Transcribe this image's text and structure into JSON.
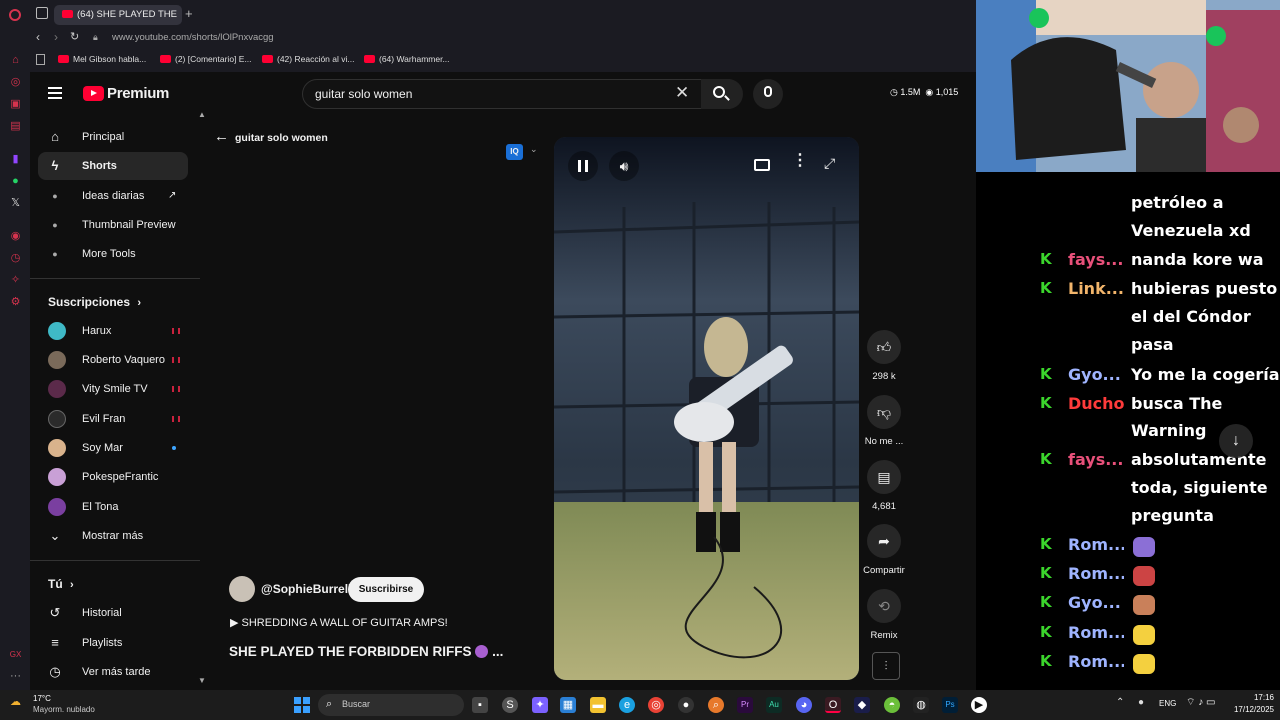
{
  "browser": {
    "tab_title": "(64) SHE PLAYED THE",
    "url": "www.youtube.com/shorts/lOlPnxvacgg",
    "bookmarks": [
      "Mel Gibson habla...",
      "(2) [Comentario] E...",
      "(42) Reacción al vi...",
      "(64) Warhammer..."
    ]
  },
  "youtube": {
    "brand": "Premium",
    "search_value": "guitar solo women",
    "stats": {
      "views": "1.5M",
      "watching": "1,015"
    },
    "nav": [
      {
        "label": "Principal",
        "icon": "home-icon"
      },
      {
        "label": "Shorts",
        "icon": "shorts-icon"
      },
      {
        "label": "Ideas diarias",
        "icon": "iq-icon"
      },
      {
        "label": "Thumbnail Preview",
        "icon": "iq-icon"
      },
      {
        "label": "More Tools",
        "icon": "iq-icon"
      }
    ],
    "subs_title": "Suscripciones",
    "subscriptions": [
      {
        "name": "Harux",
        "color": "#3fb9c6"
      },
      {
        "name": "Roberto Vaquero",
        "color": "#7a6a5a"
      },
      {
        "name": "Vity Smile TV",
        "color": "#5b2a4a"
      },
      {
        "name": "Evil Fran",
        "color": "#2b2b2b"
      },
      {
        "name": "Soy Mar",
        "color": "#d9b38c"
      },
      {
        "name": "PokespeFrantic",
        "color": "#c9a0d6"
      },
      {
        "name": "El Tona",
        "color": "#7a3fa0"
      }
    ],
    "show_more": "Mostrar más",
    "you_title": "Tú",
    "you_items": [
      {
        "label": "Historial",
        "icon": "history-icon"
      },
      {
        "label": "Playlists",
        "icon": "playlist-icon"
      },
      {
        "label": "Ver más tarde",
        "icon": "clock-icon"
      }
    ],
    "back_label": "guitar solo women",
    "channel": "@SophieBurrell",
    "subscribe": "Suscribirse",
    "playlist_line": "SHREDDING A WALL OF GUITAR AMPS!",
    "video_title": "SHE PLAYED THE FORBIDDEN RIFFS",
    "title_ellipsis": "...",
    "actions": {
      "likes": "298 k",
      "dislike": "No me ...",
      "comments": "4,681",
      "share": "Compartir",
      "remix": "Remix"
    }
  },
  "chat": {
    "lines": [
      {
        "user": "",
        "msg": "petróleo a",
        "color": "#fff"
      },
      {
        "user": "",
        "msg": "Venezuela xd",
        "color": "#fff"
      },
      {
        "user": "fays...",
        "msg": "nanda kore wa",
        "color": "#e8507a"
      },
      {
        "user": "Link...",
        "msg": "hubieras puesto",
        "color": "#f2b56b"
      },
      {
        "user": "",
        "msg": "el del Cóndor",
        "color": "#fff"
      },
      {
        "user": "",
        "msg": "pasa",
        "color": "#fff"
      },
      {
        "user": "Gyo...",
        "msg": "Yo me la cogería",
        "color": "#9fb4ff"
      },
      {
        "user": "Ducho",
        "msg": "busca The",
        "color": "#ff3b3b"
      },
      {
        "user": "",
        "msg": "Warning",
        "color": "#fff"
      },
      {
        "user": "fays...",
        "msg": "absolutamente",
        "color": "#e8507a"
      },
      {
        "user": "",
        "msg": "toda, siguiente",
        "color": "#fff"
      },
      {
        "user": "",
        "msg": "pregunta",
        "color": "#fff"
      },
      {
        "user": "Rom...",
        "msg": "",
        "color": "#9fb4ff"
      },
      {
        "user": "Rom...",
        "msg": "",
        "color": "#9fb4ff"
      },
      {
        "user": "Gyo...",
        "msg": "",
        "color": "#9fb4ff"
      },
      {
        "user": "Rom...",
        "msg": "",
        "color": "#9fb4ff"
      },
      {
        "user": "Rom...",
        "msg": "",
        "color": "#9fb4ff"
      }
    ]
  },
  "taskbar": {
    "temp": "17°C",
    "weather": "Mayorm. nublado",
    "search": "Buscar",
    "lang": "ENG",
    "time": "17:16",
    "date": "17/12/2025"
  }
}
